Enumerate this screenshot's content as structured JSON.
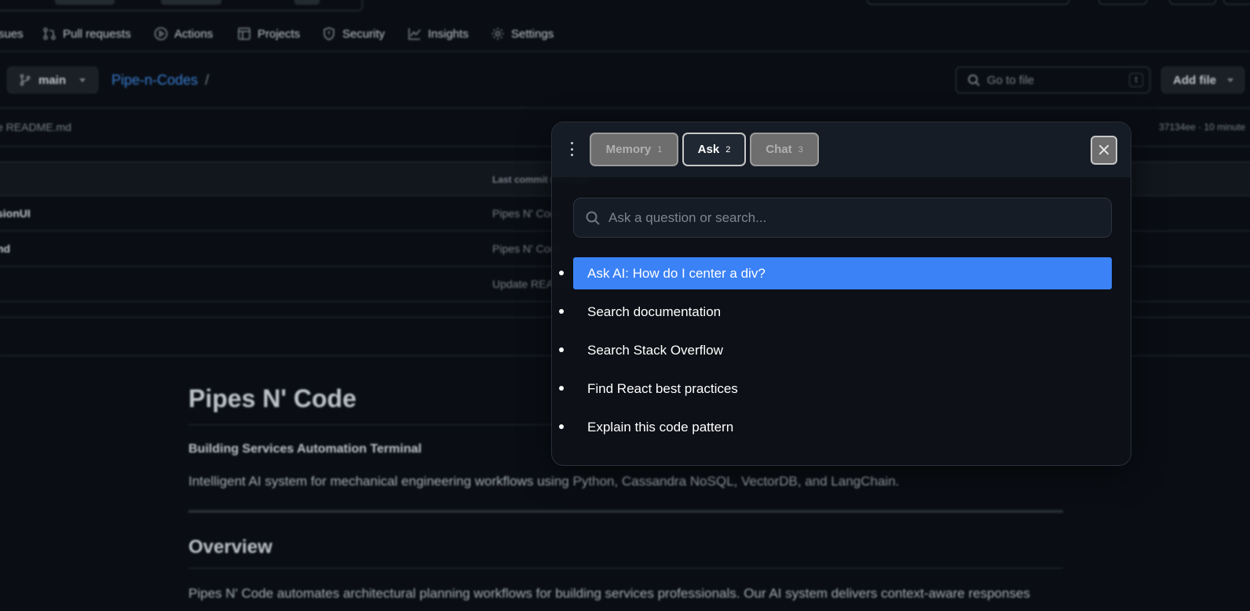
{
  "repo_nav": {
    "items": [
      {
        "label": "sues",
        "icon": "issues-icon"
      },
      {
        "label": "Pull requests",
        "icon": "pull-request-icon"
      },
      {
        "label": "Actions",
        "icon": "play-circle-icon"
      },
      {
        "label": "Projects",
        "icon": "table-icon"
      },
      {
        "label": "Security",
        "icon": "shield-icon"
      },
      {
        "label": "Insights",
        "icon": "graph-icon"
      },
      {
        "label": "Settings",
        "icon": "gear-icon"
      }
    ]
  },
  "branch": {
    "label": "main"
  },
  "breadcrumb": {
    "repo": "Pipe-n-Codes",
    "separator": "/"
  },
  "go_to_file": {
    "placeholder": "Go to file",
    "shortcut": "t"
  },
  "add_file": {
    "label": "Add file"
  },
  "latest_commit": {
    "message": "e README.md",
    "hash_time": "37134ee · 10 minute"
  },
  "file_table": {
    "header": "Last commit message",
    "rows": [
      {
        "name": "sionUI",
        "commit": "Pipes N' Code"
      },
      {
        "name": "nd",
        "commit": "Pipes N' Code"
      },
      {
        "name": "",
        "commit": "Update READM"
      }
    ]
  },
  "readme": {
    "title": "Pipes N' Code",
    "subtitle": "Building Services Automation Terminal",
    "description": "Intelligent AI system for mechanical engineering workflows using Python, Cassandra NoSQL, VectorDB, and LangChain.",
    "overview_heading": "Overview",
    "overview_text": "Pipes N' Code automates architectural planning workflows for building services professionals. Our AI system delivers context-aware responses"
  },
  "palette": {
    "tabs": [
      {
        "label": "Memory",
        "shortcut": "1",
        "active": false
      },
      {
        "label": "Ask",
        "shortcut": "2",
        "active": true
      },
      {
        "label": "Chat",
        "shortcut": "3",
        "active": false
      }
    ],
    "search": {
      "placeholder": "Ask a question or search...",
      "value": ""
    },
    "results": [
      {
        "label": "Ask AI: How do I center a div?",
        "selected": true
      },
      {
        "label": "Search documentation",
        "selected": false
      },
      {
        "label": "Search Stack Overflow",
        "selected": false
      },
      {
        "label": "Find React best practices",
        "selected": false
      },
      {
        "label": "Explain this code pattern",
        "selected": false
      }
    ],
    "colors": {
      "selected": "#3b82f6",
      "modal_bg": "#0d1117"
    }
  }
}
